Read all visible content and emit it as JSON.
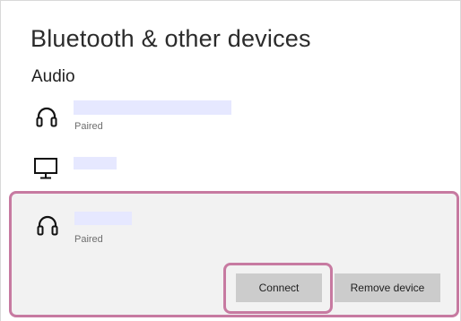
{
  "page": {
    "title": "Bluetooth & other devices"
  },
  "audio": {
    "heading": "Audio",
    "devices": [
      {
        "icon": "headphones-icon",
        "name": "",
        "status": "Paired"
      },
      {
        "icon": "monitor-icon",
        "name": "",
        "status": ""
      },
      {
        "icon": "headphones-icon",
        "name": "",
        "status": "Paired",
        "selected": true
      }
    ]
  },
  "actions": {
    "connect_label": "Connect",
    "remove_label": "Remove device"
  },
  "colors": {
    "highlight": "#c77aa1",
    "name_redaction": "#e6e8ff",
    "selected_background": "#f2f2f2",
    "button_background": "#cccccc"
  }
}
